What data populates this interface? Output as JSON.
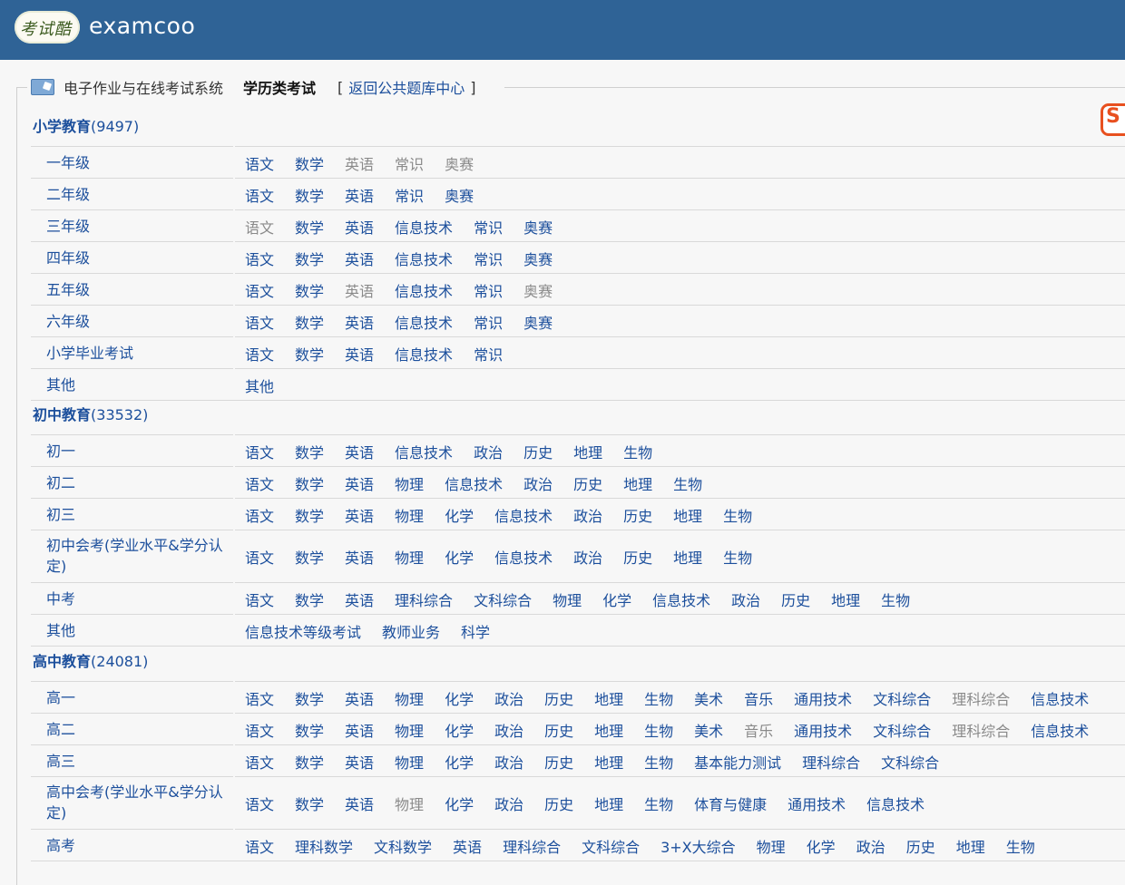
{
  "header": {
    "logo_badge": "考试酷",
    "logo_text": "examcoo"
  },
  "nav": {
    "system_name": "电子作业与在线考试系统",
    "current": "学历类考试",
    "bracket_open": "[",
    "back_link": "返回公共题库中心",
    "bracket_close": "]"
  },
  "side_badge": "S",
  "sections": [
    {
      "title": "小学教育",
      "count": "(9497)",
      "rows": [
        {
          "cat": "一年级",
          "subjects": [
            [
              "语文",
              1
            ],
            [
              "数学",
              1
            ],
            [
              "英语",
              0
            ],
            [
              "常识",
              0
            ],
            [
              "奥赛",
              0
            ]
          ]
        },
        {
          "cat": "二年级",
          "subjects": [
            [
              "语文",
              1
            ],
            [
              "数学",
              1
            ],
            [
              "英语",
              1
            ],
            [
              "常识",
              1
            ],
            [
              "奥赛",
              1
            ]
          ]
        },
        {
          "cat": "三年级",
          "subjects": [
            [
              "语文",
              0
            ],
            [
              "数学",
              1
            ],
            [
              "英语",
              1
            ],
            [
              "信息技术",
              1
            ],
            [
              "常识",
              1
            ],
            [
              "奥赛",
              1
            ]
          ]
        },
        {
          "cat": "四年级",
          "subjects": [
            [
              "语文",
              1
            ],
            [
              "数学",
              1
            ],
            [
              "英语",
              1
            ],
            [
              "信息技术",
              1
            ],
            [
              "常识",
              1
            ],
            [
              "奥赛",
              1
            ]
          ]
        },
        {
          "cat": "五年级",
          "subjects": [
            [
              "语文",
              1
            ],
            [
              "数学",
              1
            ],
            [
              "英语",
              0
            ],
            [
              "信息技术",
              1
            ],
            [
              "常识",
              1
            ],
            [
              "奥赛",
              0
            ]
          ]
        },
        {
          "cat": "六年级",
          "subjects": [
            [
              "语文",
              1
            ],
            [
              "数学",
              1
            ],
            [
              "英语",
              1
            ],
            [
              "信息技术",
              1
            ],
            [
              "常识",
              1
            ],
            [
              "奥赛",
              1
            ]
          ]
        },
        {
          "cat": "小学毕业考试",
          "subjects": [
            [
              "语文",
              1
            ],
            [
              "数学",
              1
            ],
            [
              "英语",
              1
            ],
            [
              "信息技术",
              1
            ],
            [
              "常识",
              1
            ]
          ]
        },
        {
          "cat": "其他",
          "subjects": [
            [
              "其他",
              1
            ]
          ]
        }
      ]
    },
    {
      "title": "初中教育",
      "count": "(33532)",
      "rows": [
        {
          "cat": "初一",
          "subjects": [
            [
              "语文",
              1
            ],
            [
              "数学",
              1
            ],
            [
              "英语",
              1
            ],
            [
              "信息技术",
              1
            ],
            [
              "政治",
              1
            ],
            [
              "历史",
              1
            ],
            [
              "地理",
              1
            ],
            [
              "生物",
              1
            ]
          ]
        },
        {
          "cat": "初二",
          "subjects": [
            [
              "语文",
              1
            ],
            [
              "数学",
              1
            ],
            [
              "英语",
              1
            ],
            [
              "物理",
              1
            ],
            [
              "信息技术",
              1
            ],
            [
              "政治",
              1
            ],
            [
              "历史",
              1
            ],
            [
              "地理",
              1
            ],
            [
              "生物",
              1
            ]
          ]
        },
        {
          "cat": "初三",
          "subjects": [
            [
              "语文",
              1
            ],
            [
              "数学",
              1
            ],
            [
              "英语",
              1
            ],
            [
              "物理",
              1
            ],
            [
              "化学",
              1
            ],
            [
              "信息技术",
              1
            ],
            [
              "政治",
              1
            ],
            [
              "历史",
              1
            ],
            [
              "地理",
              1
            ],
            [
              "生物",
              1
            ]
          ]
        },
        {
          "cat": "初中会考(学业水平&学分认定)",
          "subjects": [
            [
              "语文",
              1
            ],
            [
              "数学",
              1
            ],
            [
              "英语",
              1
            ],
            [
              "物理",
              1
            ],
            [
              "化学",
              1
            ],
            [
              "信息技术",
              1
            ],
            [
              "政治",
              1
            ],
            [
              "历史",
              1
            ],
            [
              "地理",
              1
            ],
            [
              "生物",
              1
            ]
          ]
        },
        {
          "cat": "中考",
          "subjects": [
            [
              "语文",
              1
            ],
            [
              "数学",
              1
            ],
            [
              "英语",
              1
            ],
            [
              "理科综合",
              1
            ],
            [
              "文科综合",
              1
            ],
            [
              "物理",
              1
            ],
            [
              "化学",
              1
            ],
            [
              "信息技术",
              1
            ],
            [
              "政治",
              1
            ],
            [
              "历史",
              1
            ],
            [
              "地理",
              1
            ],
            [
              "生物",
              1
            ]
          ]
        },
        {
          "cat": "其他",
          "subjects": [
            [
              "信息技术等级考试",
              1
            ],
            [
              "教师业务",
              1
            ],
            [
              "科学",
              1
            ]
          ]
        }
      ]
    },
    {
      "title": "高中教育",
      "count": "(24081)",
      "rows": [
        {
          "cat": "高一",
          "subjects": [
            [
              "语文",
              1
            ],
            [
              "数学",
              1
            ],
            [
              "英语",
              1
            ],
            [
              "物理",
              1
            ],
            [
              "化学",
              1
            ],
            [
              "政治",
              1
            ],
            [
              "历史",
              1
            ],
            [
              "地理",
              1
            ],
            [
              "生物",
              1
            ],
            [
              "美术",
              1
            ],
            [
              "音乐",
              1
            ],
            [
              "通用技术",
              1
            ],
            [
              "文科综合",
              1
            ],
            [
              "理科综合",
              0
            ],
            [
              "信息技术",
              1
            ]
          ]
        },
        {
          "cat": "高二",
          "subjects": [
            [
              "语文",
              1
            ],
            [
              "数学",
              1
            ],
            [
              "英语",
              1
            ],
            [
              "物理",
              1
            ],
            [
              "化学",
              1
            ],
            [
              "政治",
              1
            ],
            [
              "历史",
              1
            ],
            [
              "地理",
              1
            ],
            [
              "生物",
              1
            ],
            [
              "美术",
              1
            ],
            [
              "音乐",
              0
            ],
            [
              "通用技术",
              1
            ],
            [
              "文科综合",
              1
            ],
            [
              "理科综合",
              0
            ],
            [
              "信息技术",
              1
            ]
          ]
        },
        {
          "cat": "高三",
          "subjects": [
            [
              "语文",
              1
            ],
            [
              "数学",
              1
            ],
            [
              "英语",
              1
            ],
            [
              "物理",
              1
            ],
            [
              "化学",
              1
            ],
            [
              "政治",
              1
            ],
            [
              "历史",
              1
            ],
            [
              "地理",
              1
            ],
            [
              "生物",
              1
            ],
            [
              "基本能力测试",
              1
            ],
            [
              "理科综合",
              1
            ],
            [
              "文科综合",
              1
            ]
          ]
        },
        {
          "cat": "高中会考(学业水平&学分认定)",
          "subjects": [
            [
              "语文",
              1
            ],
            [
              "数学",
              1
            ],
            [
              "英语",
              1
            ],
            [
              "物理",
              0
            ],
            [
              "化学",
              1
            ],
            [
              "政治",
              1
            ],
            [
              "历史",
              1
            ],
            [
              "地理",
              1
            ],
            [
              "生物",
              1
            ],
            [
              "体育与健康",
              1
            ],
            [
              "通用技术",
              1
            ],
            [
              "信息技术",
              1
            ]
          ]
        },
        {
          "cat": "高考",
          "subjects": [
            [
              "语文",
              1
            ],
            [
              "理科数学",
              1
            ],
            [
              "文科数学",
              1
            ],
            [
              "英语",
              1
            ],
            [
              "理科综合",
              1
            ],
            [
              "文科综合",
              1
            ],
            [
              "3+X大综合",
              1
            ],
            [
              "物理",
              1
            ],
            [
              "化学",
              1
            ],
            [
              "政治",
              1
            ],
            [
              "历史",
              1
            ],
            [
              "地理",
              1
            ],
            [
              "生物",
              1
            ]
          ]
        }
      ]
    }
  ]
}
